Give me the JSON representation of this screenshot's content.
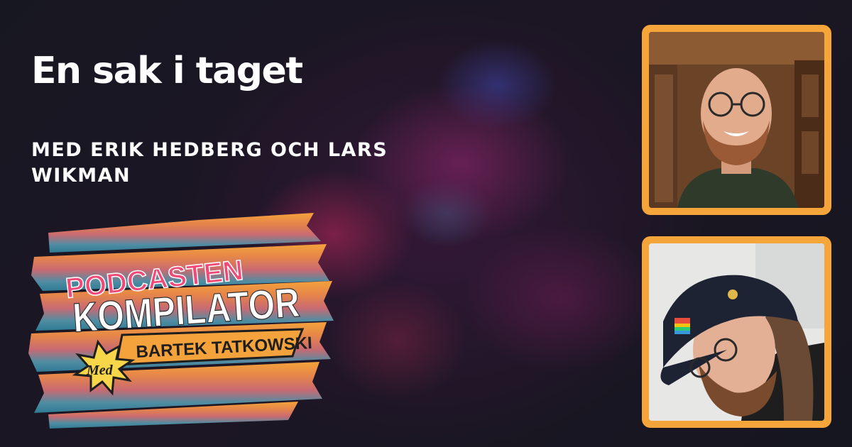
{
  "title": "En sak i taget",
  "subtitle": "Med Erik Hedberg och Lars Wikman",
  "logo": {
    "line1": "PODCASTEN",
    "line2": "KOMPILATOR",
    "burst_text": "Med",
    "banner_text": "BARTEK TATKOWSKI"
  },
  "colors": {
    "background": "#171722",
    "frame": "#f6a53a",
    "title_text": "#ffffff",
    "logo_pink": "#f04a79",
    "logo_orange": "#f4a23b"
  }
}
